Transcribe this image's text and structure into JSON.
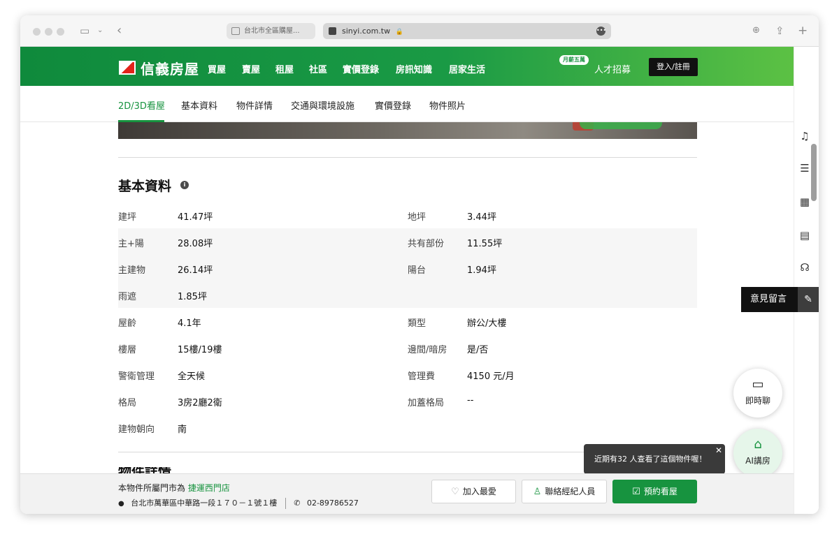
{
  "browser": {
    "tab_inactive_title": "台北市全區購屋...",
    "url": "sinyi.com.tw",
    "lock_icon": "lock-icon"
  },
  "header": {
    "logo_text": "信義房屋",
    "nav": [
      "買屋",
      "賣屋",
      "租屋",
      "社區",
      "實價登錄",
      "房訊知識",
      "居家生活"
    ],
    "salary_badge": "月薪五萬",
    "recruit": "人才招募",
    "login": "登入/註冊"
  },
  "subnav": {
    "tabs": [
      "2D/3D看屋",
      "基本資料",
      "物件詳情",
      "交通與環境設施",
      "實價登錄",
      "物件照片"
    ],
    "active_index": 0
  },
  "basic_info": {
    "title": "基本資料",
    "rows": [
      {
        "l1": "建坪",
        "v1": "41.47坪",
        "l2": "地坪",
        "v2": "3.44坪",
        "shade": false
      },
      {
        "l1": "主+陽",
        "v1": "28.08坪",
        "l2": "共有部份",
        "v2": "11.55坪",
        "shade": true
      },
      {
        "l1": "主建物",
        "v1": "26.14坪",
        "l2": "陽台",
        "v2": "1.94坪",
        "shade": true
      },
      {
        "l1": "雨遮",
        "v1": "1.85坪",
        "l2": "",
        "v2": "",
        "shade": true
      },
      {
        "l1": "屋齡",
        "v1": "4.1年",
        "l2": "類型",
        "v2": "辦公/大樓",
        "shade": false
      },
      {
        "l1": "樓層",
        "v1": "15樓/19樓",
        "l2": "邊間/暗房",
        "v2": "是/否",
        "shade": false
      },
      {
        "l1": "警衛管理",
        "v1": "全天候",
        "l2": "管理費",
        "v2": "4150 元/月",
        "shade": false
      },
      {
        "l1": "格局",
        "v1": "3房2廳2衛",
        "l2": "加蓋格局",
        "v2": "--",
        "shade": false
      },
      {
        "l1": "建物朝向",
        "v1": "南",
        "l2": "",
        "v2": "",
        "shade": false
      }
    ]
  },
  "next_section_title": "物件詳情",
  "side": {
    "feedback": "意見留言",
    "chat": "即時聊",
    "ai": "AI講房",
    "toast": "近期有32 人查看了這個物件喔！"
  },
  "bottom": {
    "store_prefix": "本物件所屬門市為",
    "store_name": "捷運西門店",
    "address": "台北市萬華區中華路一段１７０－１號１樓",
    "phone": "02-89786527",
    "favorite": "加入最愛",
    "contact": "聯絡經紀人員",
    "book": "預約看屋"
  },
  "colors": {
    "brand_green": "#17933f",
    "logo_red": "#e2231a"
  }
}
